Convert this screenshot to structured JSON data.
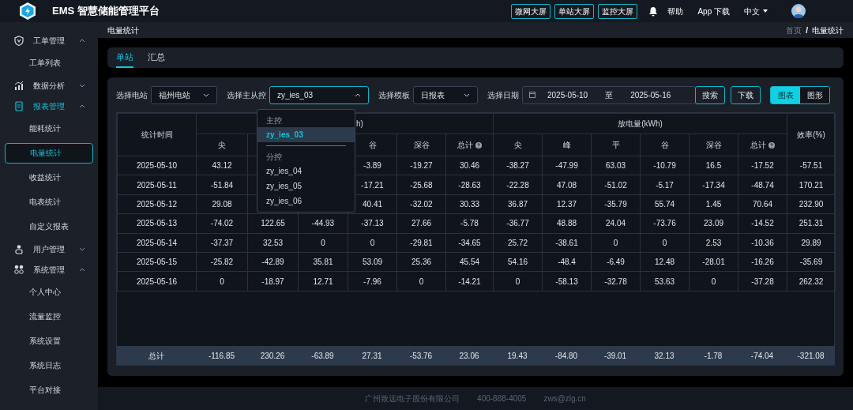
{
  "header": {
    "title": "EMS 智慧储能管理平台",
    "screens": [
      "微网大屏",
      "单站大屏",
      "监控大屏"
    ],
    "help": "帮助",
    "app": "App 下载",
    "language": "中文"
  },
  "sidebar": {
    "groups": [
      {
        "label": "工单管理",
        "expanded": true,
        "active": false,
        "children": [
          {
            "label": "工单列表",
            "selected": false
          }
        ]
      },
      {
        "label": "数据分析",
        "expanded": false,
        "active": false
      },
      {
        "label": "报表管理",
        "expanded": true,
        "active": true,
        "children": [
          {
            "label": "能耗统计",
            "selected": false
          },
          {
            "label": "电量统计",
            "selected": true
          },
          {
            "label": "收益统计",
            "selected": false
          },
          {
            "label": "电表统计",
            "selected": false
          },
          {
            "label": "自定义报表",
            "selected": false
          }
        ]
      },
      {
        "label": "用户管理",
        "expanded": false,
        "active": false
      },
      {
        "label": "系统管理",
        "expanded": true,
        "active": false,
        "children": [
          {
            "label": "个人中心",
            "selected": false
          },
          {
            "label": "流量监控",
            "selected": false
          },
          {
            "label": "系统设置",
            "selected": false
          },
          {
            "label": "系统日志",
            "selected": false
          },
          {
            "label": "平台对接",
            "selected": false
          }
        ]
      }
    ]
  },
  "page_title": "电量统计",
  "breadcrumb": {
    "items": [
      "首页",
      "电量统计"
    ],
    "separator": "/"
  },
  "tabs": [
    {
      "label": "单站",
      "selected": true
    },
    {
      "label": "汇总",
      "selected": false
    }
  ],
  "filters": [
    {
      "label": "选择电站",
      "value": "福州电站",
      "expanded": false
    },
    {
      "label": "选择主从控",
      "value": "zy_ies_03",
      "expanded": true
    },
    {
      "label": "选择模板",
      "value": "日报表",
      "expanded": false
    }
  ],
  "date": {
    "label": "选择日期",
    "start": "2025-05-10",
    "separator": "至",
    "end": "2025-05-16"
  },
  "buttons": [
    "搜索",
    "下载"
  ],
  "view_toggle": [
    {
      "label": "图表",
      "selected": true
    },
    {
      "label": "图形",
      "selected": false
    }
  ],
  "dropdown": {
    "groups": [
      {
        "title": "主控",
        "options": [
          {
            "label": "zy_ies_03",
            "selected": true
          }
        ]
      },
      {
        "title": "分控",
        "options": [
          {
            "label": "zy_ies_04",
            "selected": false
          },
          {
            "label": "zy_ies_05",
            "selected": false
          },
          {
            "label": "zy_ies_06",
            "selected": false
          }
        ]
      }
    ]
  },
  "table": {
    "time_header": "统计时间",
    "groups": [
      {
        "title": "h)",
        "columns": [
          "尖",
          null,
          null,
          "谷",
          "深谷",
          "总计"
        ]
      },
      {
        "title": "放电量(kWh)",
        "columns": [
          "尖",
          "峰",
          "平",
          "谷",
          "深谷",
          "总计"
        ]
      }
    ],
    "efficiency_header": "效率(%)",
    "rows": [
      [
        "2025-05-10",
        "43.12",
        null,
        null,
        "-3.89",
        "-19.27",
        "30.46",
        "-38.27",
        "-47.99",
        "63.03",
        "-10.79",
        "16.5",
        "-17.52",
        "-57.51"
      ],
      [
        "2025-05-11",
        "-51.84",
        null,
        null,
        "-17.21",
        "-25.68",
        "-28.63",
        "-22.28",
        "47.08",
        "-51.02",
        "-5.17",
        "-17.34",
        "-48.74",
        "170.21"
      ],
      [
        "2025-05-12",
        "29.08",
        null,
        null,
        "40.41",
        "-32.02",
        "30.33",
        "36.87",
        "12.37",
        "-35.79",
        "55.74",
        "1.45",
        "70.64",
        "232.90"
      ],
      [
        "2025-05-13",
        "-74.02",
        "122.65",
        "-44.93",
        "-37.13",
        "27.66",
        "-5.78",
        "-36.77",
        "48.88",
        "24.04",
        "-73.76",
        "23.09",
        "-14.52",
        "251.31"
      ],
      [
        "2025-05-14",
        "-37.37",
        "32.53",
        "0",
        "0",
        "-29.81",
        "-34.65",
        "25.72",
        "-38.61",
        "0",
        "0",
        "2.53",
        "-10.36",
        "29.89"
      ],
      [
        "2025-05-15",
        "-25.82",
        "-42.89",
        "35.81",
        "53.09",
        "25.36",
        "45.54",
        "54.16",
        "-48.4",
        "-6.49",
        "12.48",
        "-28.01",
        "-16.26",
        "-35.69"
      ],
      [
        "2025-05-16",
        "0",
        "-18.97",
        "12.71",
        "-7.96",
        "0",
        "-14.21",
        "0",
        "-58.13",
        "-32.78",
        "53.63",
        "0",
        "-37.28",
        "262.32"
      ]
    ],
    "total": [
      "总计",
      "-116.85",
      "230.26",
      "-63.89",
      "27.31",
      "-53.76",
      "23.06",
      "19.43",
      "-84.80",
      "-39.01",
      "32.13",
      "-1.78",
      "-74.04",
      "-321.08"
    ]
  },
  "footer": [
    "广州致远电子股份有限公司",
    "400-888-4005",
    "zws@zlg.cn"
  ]
}
